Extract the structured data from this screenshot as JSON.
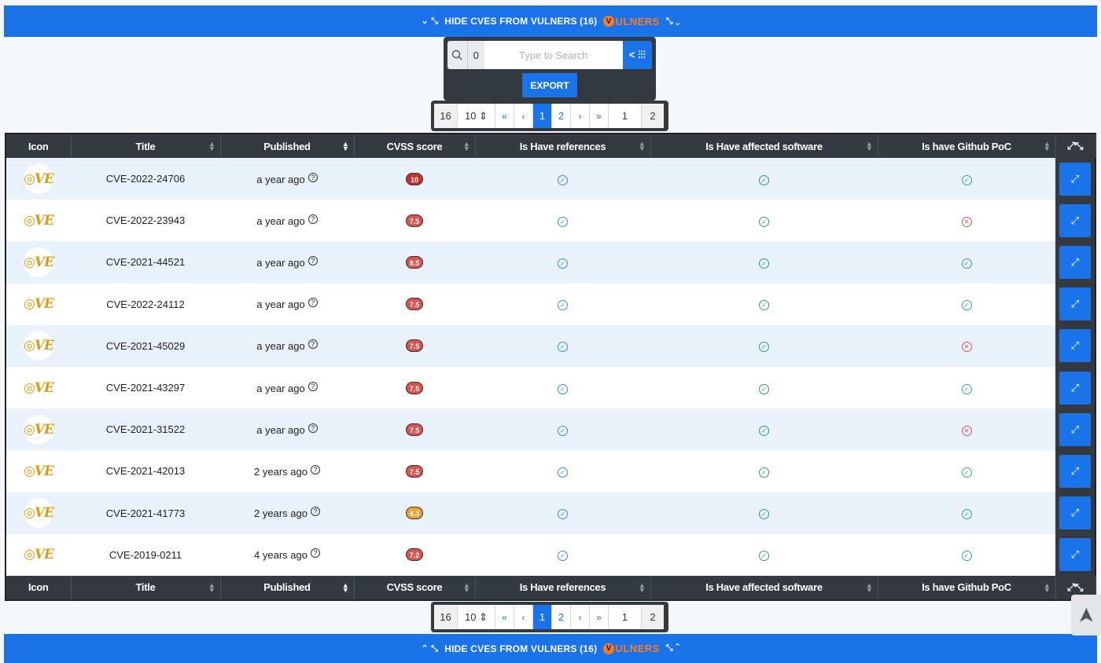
{
  "banner": {
    "label": "HIDE CVES FROM VULNERS (16)",
    "brand": "ULNERS",
    "brand_letter": "V",
    "brand_color": "#ff7a1a",
    "accent": "#1a73e8"
  },
  "search": {
    "count": "0",
    "placeholder": "Type to Search",
    "filter_label": "< ⫶⫶⫶",
    "export_label": "EXPORT"
  },
  "pager": {
    "total": "16",
    "page_size": "10 ⇕",
    "first": "«",
    "prev": "‹",
    "pages": [
      "1",
      "2"
    ],
    "next": "›",
    "last": "»",
    "current": "1",
    "page_count": "2"
  },
  "columns": [
    "Icon",
    "Title",
    "Published",
    "CVSS score",
    "Is Have references",
    "Is Have affected software",
    "Is have Github PoC"
  ],
  "rows": [
    {
      "title": "CVE-2022-24706",
      "published": "a year ago",
      "score": "10",
      "score_color": "#c9302c",
      "refs": "ok",
      "affected": "ok",
      "poc": "ok"
    },
    {
      "title": "CVE-2022-23943",
      "published": "a year ago",
      "score": "7.5",
      "score_color": "#d9534f",
      "refs": "ok",
      "affected": "ok",
      "poc": "no"
    },
    {
      "title": "CVE-2021-44521",
      "published": "a year ago",
      "score": "8.5",
      "score_color": "#d9534f",
      "refs": "ok",
      "affected": "ok",
      "poc": "ok"
    },
    {
      "title": "CVE-2022-24112",
      "published": "a year ago",
      "score": "7.5",
      "score_color": "#d9534f",
      "refs": "ok",
      "affected": "ok",
      "poc": "ok"
    },
    {
      "title": "CVE-2021-45029",
      "published": "a year ago",
      "score": "7.5",
      "score_color": "#d9534f",
      "refs": "ok",
      "affected": "ok",
      "poc": "no"
    },
    {
      "title": "CVE-2021-43297",
      "published": "a year ago",
      "score": "7.5",
      "score_color": "#d9534f",
      "refs": "ok",
      "affected": "ok",
      "poc": "ok"
    },
    {
      "title": "CVE-2021-31522",
      "published": "a year ago",
      "score": "7.5",
      "score_color": "#d9534f",
      "refs": "ok",
      "affected": "ok",
      "poc": "no"
    },
    {
      "title": "CVE-2021-42013",
      "published": "2 years ago",
      "score": "7.5",
      "score_color": "#d9534f",
      "refs": "ok",
      "affected": "ok",
      "poc": "ok"
    },
    {
      "title": "CVE-2021-41773",
      "published": "2 years ago",
      "score": "4.3",
      "score_color": "#f0a030",
      "refs": "ok",
      "affected": "ok",
      "poc": "ok"
    },
    {
      "title": "CVE-2019-0211",
      "published": "4 years ago",
      "score": "7.2",
      "score_color": "#d9534f",
      "refs": "ok",
      "affected": "ok",
      "poc": "ok"
    }
  ],
  "icons": {
    "row_icon": "cve-logo-icon",
    "help": "?",
    "ok": "✓",
    "no": "✕",
    "expand": "⤢",
    "scroll_top": "➤"
  }
}
